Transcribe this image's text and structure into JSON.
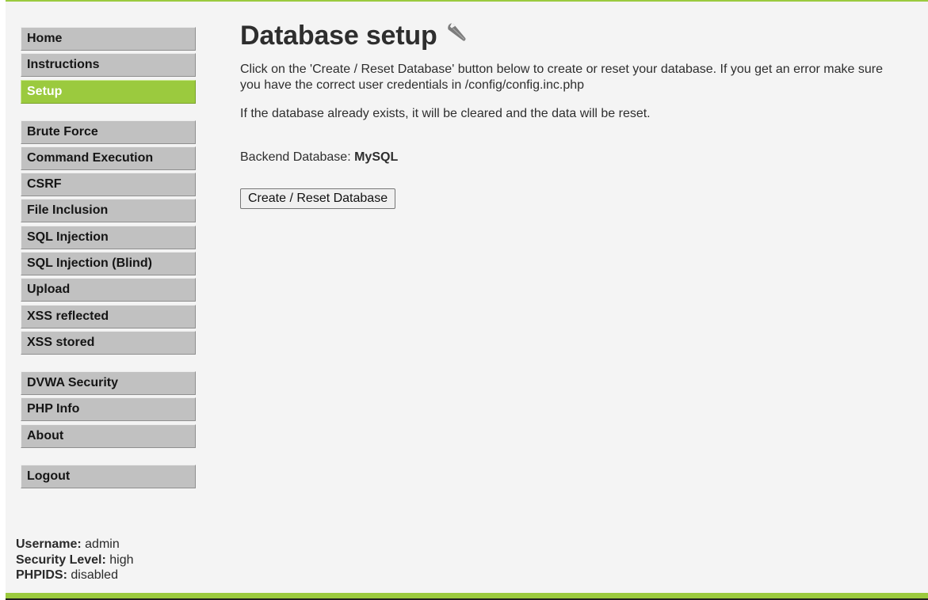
{
  "sidebar": {
    "groups": [
      [
        "Home",
        "Instructions",
        "Setup"
      ],
      [
        "Brute Force",
        "Command Execution",
        "CSRF",
        "File Inclusion",
        "SQL Injection",
        "SQL Injection (Blind)",
        "Upload",
        "XSS reflected",
        "XSS stored"
      ],
      [
        "DVWA Security",
        "PHP Info",
        "About"
      ],
      [
        "Logout"
      ]
    ],
    "selected": "Setup"
  },
  "main": {
    "title": "Database setup",
    "title_icon": "wrench-icon",
    "paragraph1": "Click on the 'Create / Reset Database' button below to create or reset your database. If you get an error make sure you have the correct user credentials in /config/config.inc.php",
    "paragraph2": "If the database already exists, it will be cleared and the data will be reset.",
    "backend_label": "Backend Database: ",
    "backend_value": "MySQL",
    "button_label": "Create / Reset Database"
  },
  "user_info": {
    "username_label": "Username:",
    "username_value": "admin",
    "security_label": "Security Level:",
    "security_value": "high",
    "phpids_label": "PHPIDS:",
    "phpids_value": "disabled"
  },
  "colors": {
    "accent": "#9bca3e",
    "menu_bg": "#c1c1c1",
    "page_bg": "#f4f4f4"
  }
}
